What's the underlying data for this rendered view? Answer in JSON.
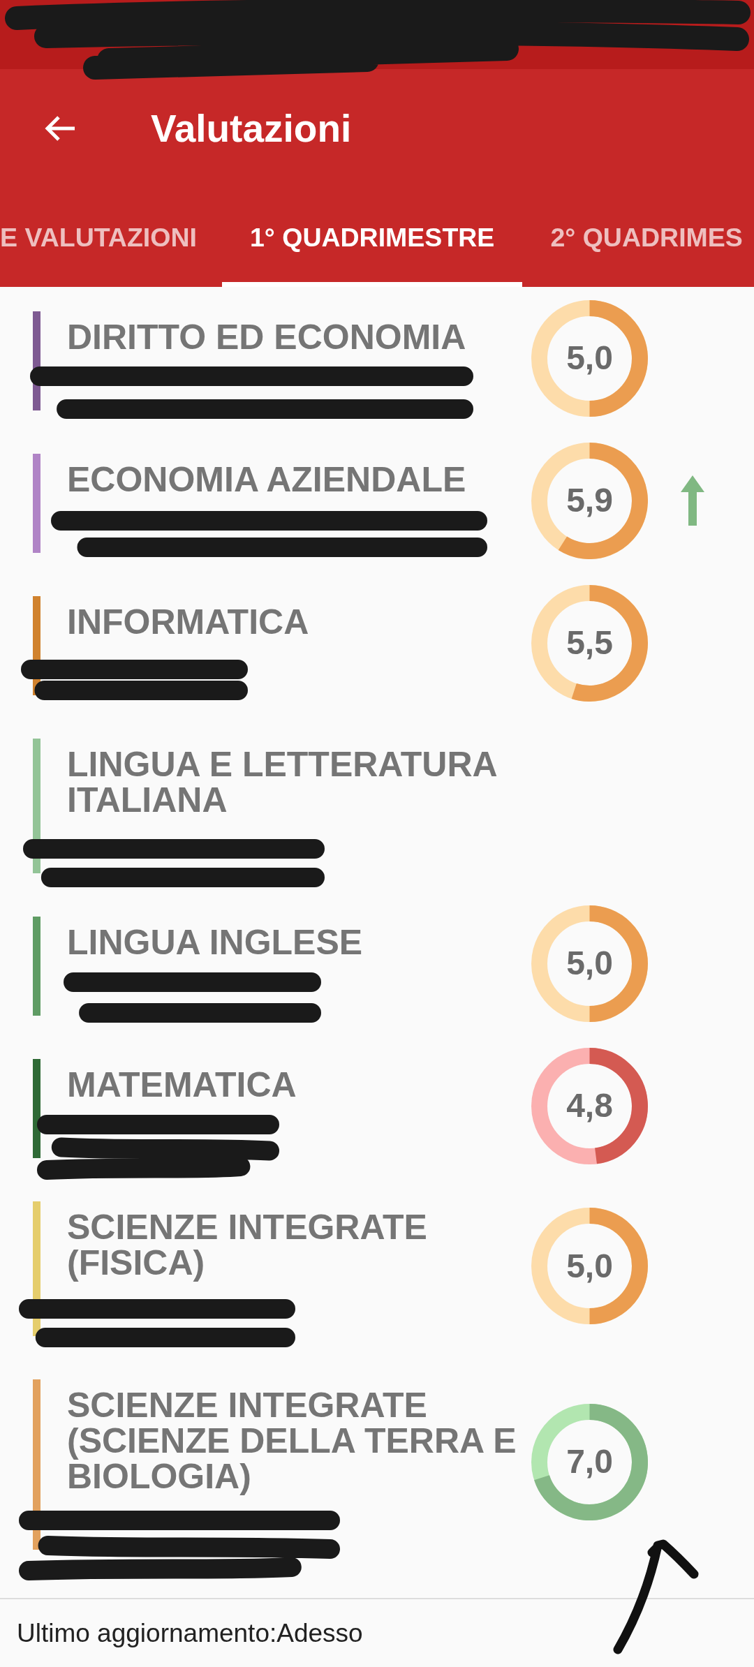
{
  "status_bar": {
    "redacted": true
  },
  "app_bar": {
    "title": "Valutazioni"
  },
  "tabs": [
    {
      "label": "E VALUTAZIONI",
      "selected": false
    },
    {
      "label": "1° QUADRIMESTRE",
      "selected": true
    },
    {
      "label": "2° QUADRIMES",
      "selected": false
    }
  ],
  "subjects": [
    {
      "name": "DIRITTO ED ECONOMIA",
      "color": "#7e5a92",
      "teacher_redacted": true,
      "grade": {
        "value": "5,0",
        "kind": "warning"
      },
      "trend_up": false
    },
    {
      "name": "ECONOMIA AZIENDALE",
      "color": "#b084c6",
      "teacher_redacted": true,
      "grade": {
        "value": "5,9",
        "kind": "warning"
      },
      "trend_up": true
    },
    {
      "name": "INFORMATICA",
      "color": "#d0822e",
      "teacher_redacted": true,
      "grade": {
        "value": "5,5",
        "kind": "warning"
      },
      "trend_up": false
    },
    {
      "name": "LINGUA E LETTERATURA ITALIANA",
      "color": "#93c497",
      "teacher_redacted": true,
      "trend_up": false
    },
    {
      "name": "LINGUA INGLESE",
      "color": "#5f9c64",
      "teacher_redacted": true,
      "grade": {
        "value": "5,0",
        "kind": "warning"
      },
      "trend_up": false
    },
    {
      "name": "MATEMATICA",
      "color": "#2f6a36",
      "teacher_redacted": true,
      "grade": {
        "value": "4,8",
        "kind": "danger"
      },
      "trend_up": false
    },
    {
      "name": "SCIENZE INTEGRATE (FISICA)",
      "color": "#e5cd6c",
      "teacher_redacted": true,
      "grade": {
        "value": "5,0",
        "kind": "warning"
      },
      "trend_up": false
    },
    {
      "name": "SCIENZE INTEGRATE (SCIENZE DELLA TERRA E BIOLOGIA)",
      "color": "#e2a15e",
      "teacher_redacted": true,
      "grade": {
        "value": "7,0",
        "kind": "success"
      },
      "trend_up": false
    }
  ],
  "footer": {
    "last_update": "Ultimo aggiornamento:Adesso"
  },
  "annotation": {
    "kind": "arrow"
  }
}
